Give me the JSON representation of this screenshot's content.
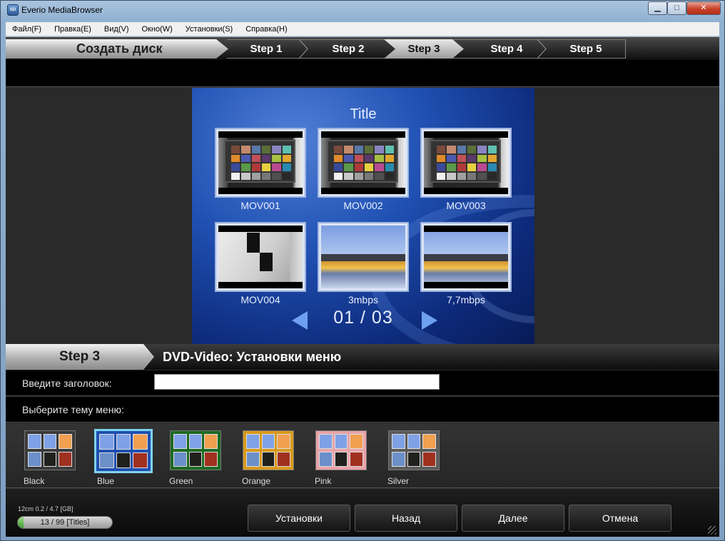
{
  "window": {
    "title": "Everio MediaBrowser",
    "icon_label": "SD",
    "controls": {
      "minimize": "▁",
      "maximize": "□",
      "close": "✕"
    }
  },
  "menubar": {
    "items": [
      "Файл(F)",
      "Правка(E)",
      "Вид(V)",
      "Окно(W)",
      "Установки(S)",
      "Справка(H)"
    ]
  },
  "steps": {
    "create_disc": "Создать диск",
    "tabs": [
      "Step 1",
      "Step 2",
      "Step 3",
      "Step 4",
      "Step 5"
    ],
    "active_index": 2
  },
  "preview": {
    "title": "Title",
    "thumbnails": [
      {
        "label": "MOV001",
        "scene": "color-chart"
      },
      {
        "label": "MOV002",
        "scene": "color-chart"
      },
      {
        "label": "MOV003",
        "scene": "color-chart"
      },
      {
        "label": "MOV004",
        "scene": "window-corner"
      },
      {
        "label": "3mbps",
        "scene": "landscape"
      },
      {
        "label": "7,7mbps",
        "scene": "landscape"
      }
    ],
    "pager": "01 / 03"
  },
  "section": {
    "step": "Step 3",
    "title": "DVD-Video: Установки меню"
  },
  "form": {
    "title_label": "Введите заголовок:",
    "title_value": "",
    "theme_label": "Выберите тему меню:"
  },
  "themes": {
    "selected": "Blue",
    "items": [
      {
        "name": "Black",
        "bg": "#3a3a3a"
      },
      {
        "name": "Blue",
        "bg": "#1f4fb1"
      },
      {
        "name": "Green",
        "bg": "#1d6a22"
      },
      {
        "name": "Orange",
        "bg": "#d99a1c"
      },
      {
        "name": "Pink",
        "bg": "#e9a3a8"
      },
      {
        "name": "Silver",
        "bg": "#5a5a5a"
      }
    ]
  },
  "status": {
    "capacity_text": "12cm 0.2 / 4.7 [GB]",
    "titles_count": "13 / 99 [Titles]",
    "capacity_fraction": 0.04
  },
  "actions": {
    "settings": "Установки",
    "back": "Назад",
    "next": "Далее",
    "cancel": "Отмена"
  },
  "colors": {
    "accent_selected": "#7ed3ee",
    "preview_blue": "#1f4fb1",
    "progress_green": "#3c9c2d"
  }
}
